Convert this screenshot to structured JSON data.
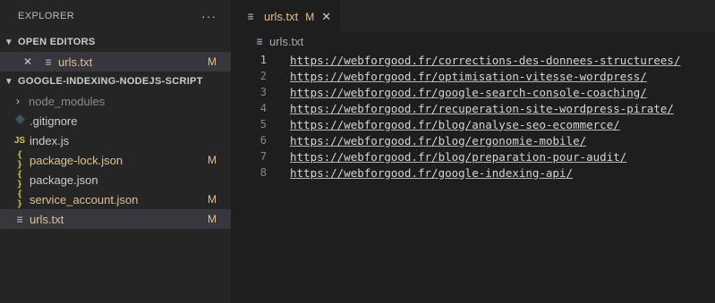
{
  "explorer": {
    "title": "EXPLORER",
    "more": "···",
    "open_editors": {
      "title": "OPEN EDITORS",
      "items": [
        {
          "close": "✕",
          "name": "urls.txt",
          "badge": "M"
        }
      ]
    },
    "project": {
      "title": "GOOGLE-INDEXING-NODEJS-SCRIPT",
      "items": [
        {
          "name": "node_modules",
          "badge": ""
        },
        {
          "name": ".gitignore",
          "badge": ""
        },
        {
          "name": "index.js",
          "badge": "",
          "icon_text": "JS"
        },
        {
          "name": "package-lock.json",
          "badge": "M",
          "icon_text": "{ }"
        },
        {
          "name": "package.json",
          "badge": "",
          "icon_text": "{ }"
        },
        {
          "name": "service_account.json",
          "badge": "M",
          "icon_text": "{ }"
        },
        {
          "name": "urls.txt",
          "badge": "M",
          "icon_text": "≡"
        }
      ]
    }
  },
  "editor": {
    "tab": {
      "label": "urls.txt",
      "badge": "M",
      "close": "✕"
    },
    "breadcrumb": "urls.txt",
    "lines": [
      {
        "num": "1",
        "text": "https://webforgood.fr/corrections-des-donnees-structurees/"
      },
      {
        "num": "2",
        "text": "https://webforgood.fr/optimisation-vitesse-wordpress/"
      },
      {
        "num": "3",
        "text": "https://webforgood.fr/google-search-console-coaching/"
      },
      {
        "num": "4",
        "text": "https://webforgood.fr/recuperation-site-wordpress-pirate/"
      },
      {
        "num": "5",
        "text": "https://webforgood.fr/blog/analyse-seo-ecommerce/"
      },
      {
        "num": "6",
        "text": "https://webforgood.fr/blog/ergonomie-mobile/"
      },
      {
        "num": "7",
        "text": "https://webforgood.fr/blog/preparation-pour-audit/"
      },
      {
        "num": "8",
        "text": "https://webforgood.fr/google-indexing-api/"
      }
    ]
  },
  "colors": {
    "modified": "#e2c08d",
    "sidebar_bg": "#252526",
    "editor_bg": "#1e1e1e",
    "selected_bg": "#37373d"
  }
}
